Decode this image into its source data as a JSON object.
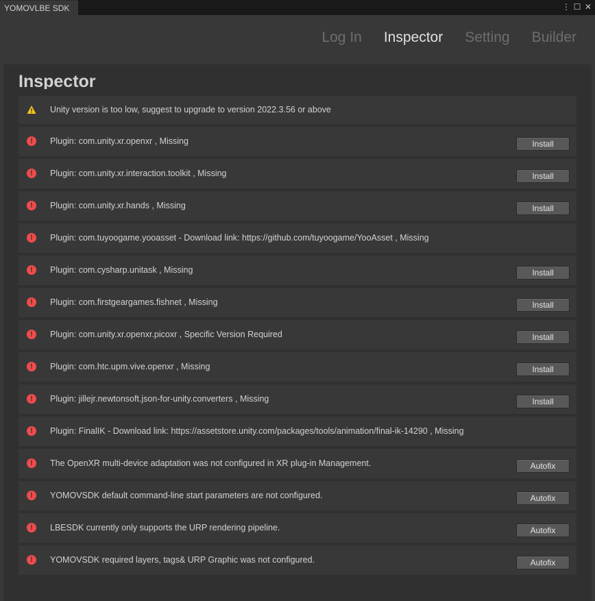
{
  "window": {
    "tab_title": "YOMOVLBE SDK",
    "controls": [
      "⋮",
      "☐",
      "✕"
    ]
  },
  "nav": {
    "tabs": [
      {
        "label": "Log In",
        "active": false
      },
      {
        "label": "Inspector",
        "active": true
      },
      {
        "label": "Setting",
        "active": false
      },
      {
        "label": "Builder",
        "active": false
      }
    ]
  },
  "panel": {
    "title": "Inspector",
    "items": [
      {
        "severity": "warning",
        "message": "Unity version is too low, suggest to upgrade to version 2022.3.56 or above",
        "action": ""
      },
      {
        "severity": "error",
        "message": "Plugin: com.unity.xr.openxr , Missing",
        "action": "Install"
      },
      {
        "severity": "error",
        "message": "Plugin: com.unity.xr.interaction.toolkit , Missing",
        "action": "Install"
      },
      {
        "severity": "error",
        "message": "Plugin: com.unity.xr.hands , Missing",
        "action": "Install"
      },
      {
        "severity": "error",
        "message": "Plugin: com.tuyoogame.yooasset - Download link: https://github.com/tuyoogame/YooAsset , Missing",
        "action": ""
      },
      {
        "severity": "error",
        "message": "Plugin: com.cysharp.unitask , Missing",
        "action": "Install"
      },
      {
        "severity": "error",
        "message": "Plugin: com.firstgeargames.fishnet , Missing",
        "action": "Install"
      },
      {
        "severity": "error",
        "message": "Plugin: com.unity.xr.openxr.picoxr , Specific Version Required",
        "action": "Install"
      },
      {
        "severity": "error",
        "message": "Plugin: com.htc.upm.vive.openxr , Missing",
        "action": "Install"
      },
      {
        "severity": "error",
        "message": "Plugin: jillejr.newtonsoft.json-for-unity.converters , Missing",
        "action": "Install"
      },
      {
        "severity": "error",
        "message": "Plugin: FinalIK - Download link: https://assetstore.unity.com/packages/tools/animation/final-ik-14290 , Missing",
        "action": ""
      },
      {
        "severity": "error",
        "message": "The OpenXR multi-device adaptation was not configured in XR plug-in Management.",
        "action": "Autofix"
      },
      {
        "severity": "error",
        "message": "YOMOVSDK default command-line start parameters are not configured.",
        "action": "Autofix"
      },
      {
        "severity": "error",
        "message": "LBESDK currently only supports the URP rendering pipeline.",
        "action": "Autofix"
      },
      {
        "severity": "error",
        "message": "YOMOVSDK required layers, tags& URP Graphic was not configured.",
        "action": "Autofix"
      }
    ]
  },
  "colors": {
    "error": "#f04b4b",
    "warning": "#f5c518",
    "background": "#383838",
    "panel": "#303030"
  }
}
